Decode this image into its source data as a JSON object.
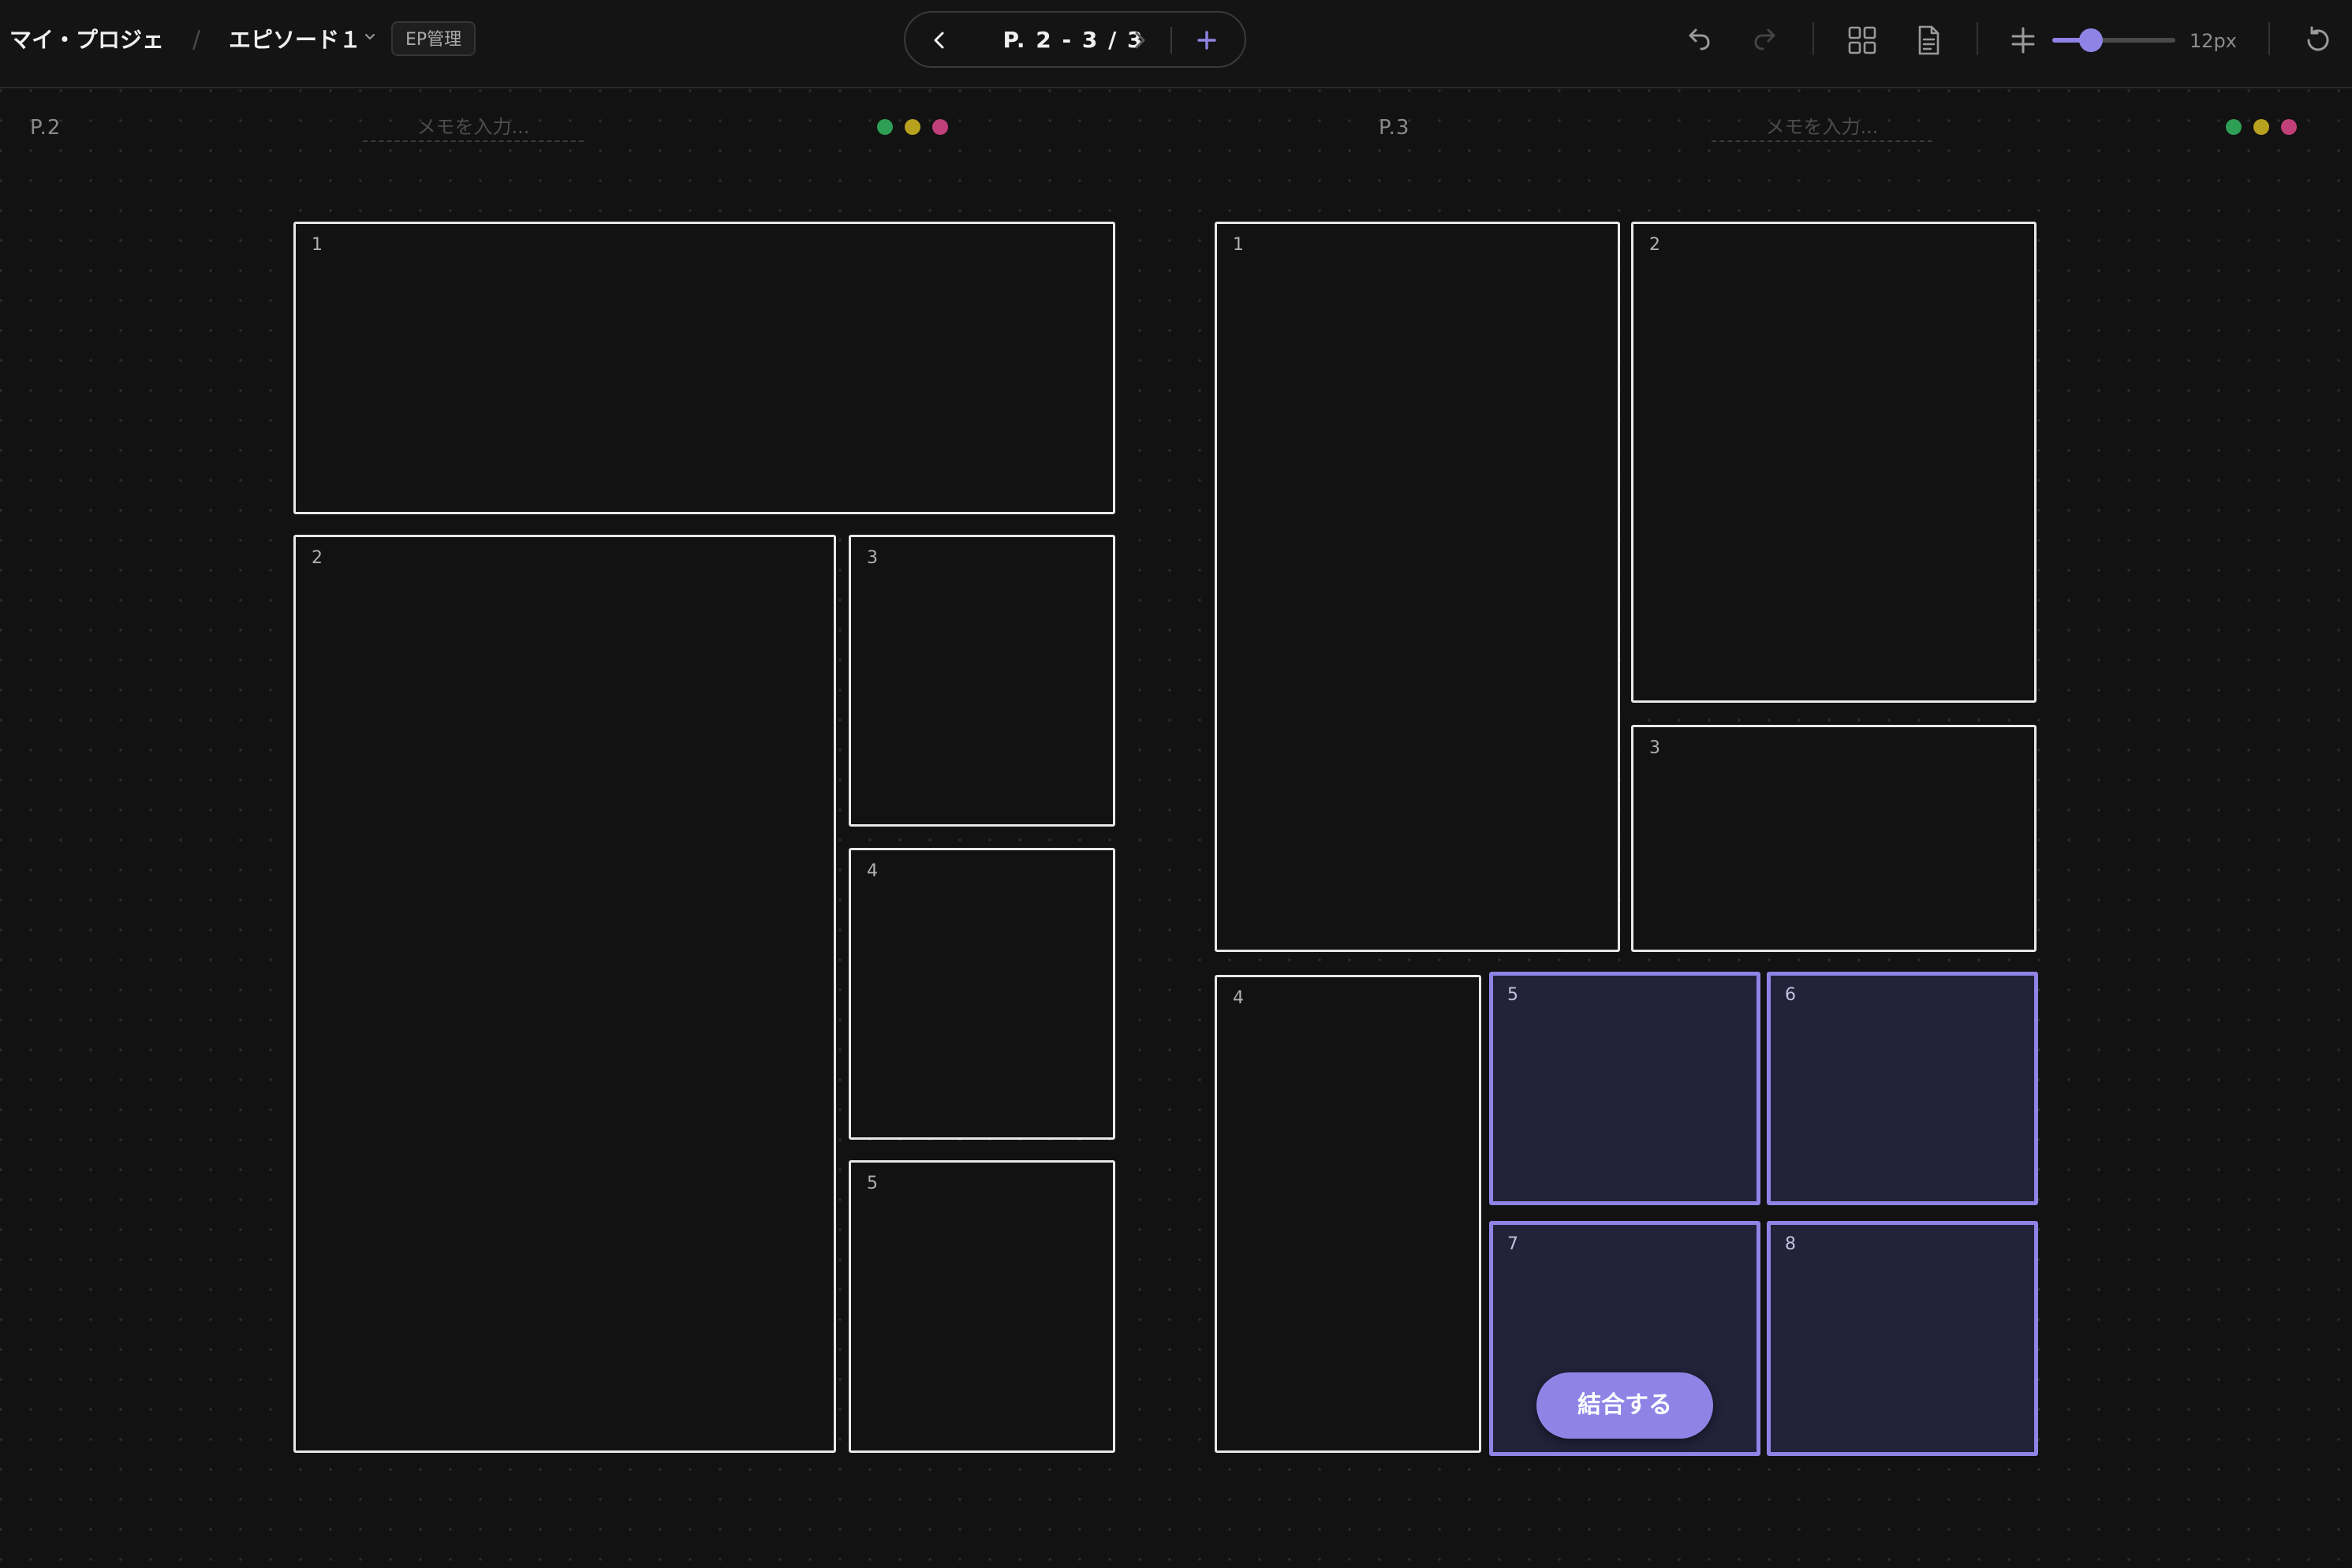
{
  "header": {
    "project_name": "マイ・プロジェ",
    "breadcrumb_separator": "/",
    "episode_name": "エピソード１",
    "ep_manage_label": "EP管理",
    "page_indicator": "P. 2 - 3 / 3",
    "add_page_label": "+",
    "font_size_value": "12px",
    "accent_color": "#8f84e6"
  },
  "pages": [
    {
      "label": "P.2",
      "memo_placeholder": "メモを入力...",
      "status_colors": [
        "#2f9e55",
        "#b8a11e",
        "#c2407a"
      ],
      "panels": [
        {
          "number": "1",
          "selected": false
        },
        {
          "number": "2",
          "selected": false
        },
        {
          "number": "3",
          "selected": false
        },
        {
          "number": "4",
          "selected": false
        },
        {
          "number": "5",
          "selected": false
        }
      ]
    },
    {
      "label": "P.3",
      "memo_placeholder": "メモを入力...",
      "status_colors": [
        "#2f9e55",
        "#b8a11e",
        "#c2407a"
      ],
      "panels": [
        {
          "number": "1",
          "selected": false
        },
        {
          "number": "2",
          "selected": false
        },
        {
          "number": "3",
          "selected": false
        },
        {
          "number": "4",
          "selected": false
        },
        {
          "number": "5",
          "selected": true
        },
        {
          "number": "6",
          "selected": true
        },
        {
          "number": "7",
          "selected": true
        },
        {
          "number": "8",
          "selected": true
        }
      ]
    }
  ],
  "merge_button_label": "結合する"
}
